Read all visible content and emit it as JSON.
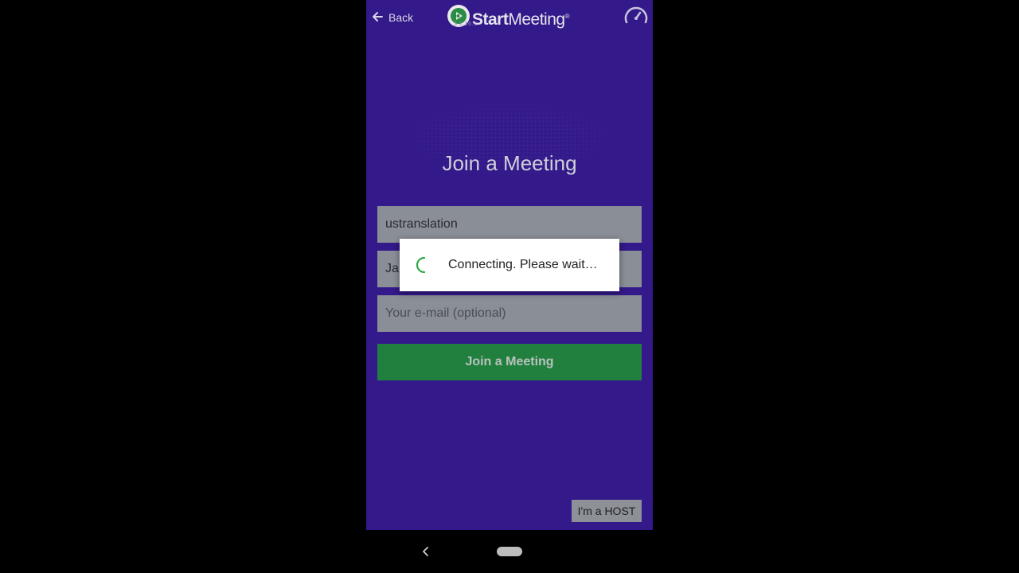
{
  "header": {
    "back_label": "Back",
    "logo_text_bold": "Start",
    "logo_text_light": "Meeting",
    "logo_trademark": "®",
    "version": "3.1.16.1",
    "icons": {
      "back": "arrow-left-icon",
      "logo": "play-circle-icon",
      "speed": "speedometer-icon"
    }
  },
  "main": {
    "title": "Join a Meeting",
    "meeting_field_value": "ustranslation",
    "name_field_value": "Ja",
    "email_field_placeholder": "Your e-mail (optional)",
    "join_button_label": "Join a Meeting",
    "host_button_label": "I'm a HOST"
  },
  "dialog": {
    "message": "Connecting. Please wait…",
    "spinner_icon": "spinner-icon"
  },
  "system_nav": {
    "back_icon": "chevron-left-icon",
    "home_icon": "home-pill-icon"
  },
  "colors": {
    "background": "#33198a",
    "join_button": "#22803f",
    "spinner": "#2ea84a",
    "field": "#8a8e96"
  }
}
